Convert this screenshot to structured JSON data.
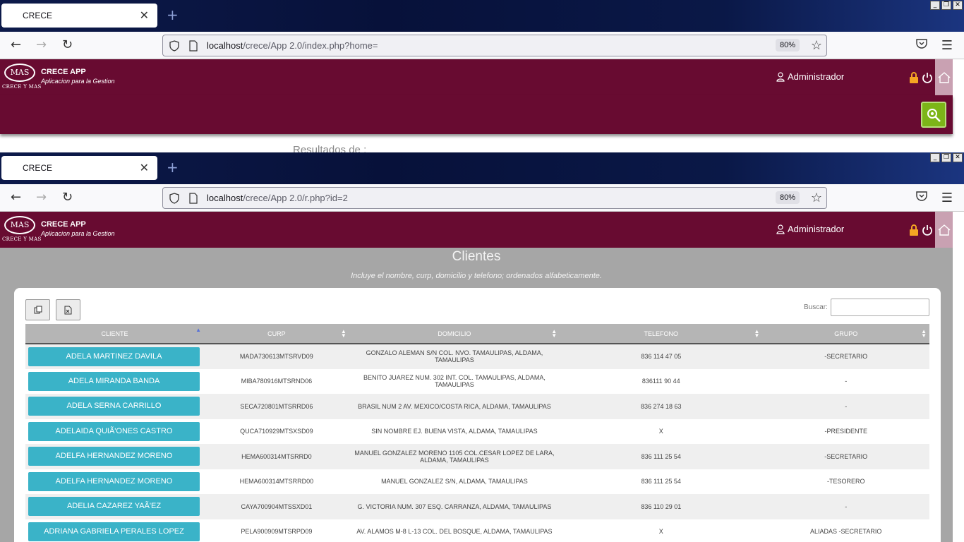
{
  "window1": {
    "tab_title": "CRECE",
    "url_host": "localhost",
    "url_path": "/crece/App 2.0/index.php?home=",
    "zoom": "80%",
    "results_label": "Resultados de :"
  },
  "window2": {
    "tab_title": "CRECE",
    "url_host": "localhost",
    "url_path": "/crece/App 2.0/r.php?id=2",
    "zoom": "80%"
  },
  "app": {
    "logo_text": "MAS",
    "logo_sub": "CRECE Y MAS",
    "name": "CRECE APP",
    "subtitle": "Aplicacion para la Gestion",
    "user": "Administrador",
    "colors": {
      "header": "#680b31",
      "accent_button": "#3ab3c8",
      "search_button": "#7cb518"
    }
  },
  "report": {
    "title": "Clientes",
    "description": "Incluye el nombre, curp, domicilio y telefono; ordenados alfabeticamente.",
    "search_label": "Buscar:",
    "search_value": "",
    "columns": [
      "CLIENTE",
      "CURP",
      "DOMICILIO",
      "TELEFONO",
      "GRUPO"
    ],
    "rows": [
      {
        "cliente": "ADELA MARTINEZ DAVILA",
        "curp": "MADA730613MTSRVD09",
        "domicilio": "GONZALO ALEMAN S/N COL. NVO. TAMAULIPAS, ALDAMA, TAMAULIPAS",
        "telefono": "836 114 47 05",
        "grupo": "-SECRETARIO"
      },
      {
        "cliente": "ADELA MIRANDA BANDA",
        "curp": "MIBA780916MTSRND06",
        "domicilio": "BENITO JUAREZ NUM. 302 INT. COL. TAMAULIPAS, ALDAMA, TAMAULIPAS",
        "telefono": "836111 90 44",
        "grupo": "-"
      },
      {
        "cliente": "ADELA SERNA CARRILLO",
        "curp": "SECA720801MTSRRD06",
        "domicilio": "BRASIL NUM 2 AV. MEXICO/COSTA RICA, ALDAMA, TAMAULIPAS",
        "telefono": "836 274 18 63",
        "grupo": "-"
      },
      {
        "cliente": "ADELAIDA QUIÃ'ONES CASTRO",
        "curp": "QUCA710929MTSXSD09",
        "domicilio": "SIN NOMBRE EJ. BUENA VISTA, ALDAMA, TAMAULIPAS",
        "telefono": "X",
        "grupo": "-PRESIDENTE"
      },
      {
        "cliente": "ADELFA HERNANDEZ MORENO",
        "curp": "HEMA600314MTSRRD0",
        "domicilio": "MANUEL GONZALEZ MORENO 1105 COL.CESAR LOPEZ DE LARA, ALDAMA, TAMAULIPAS",
        "telefono": "836 111 25 54",
        "grupo": "-SECRETARIO"
      },
      {
        "cliente": "ADELFA HERNANDEZ MORENO",
        "curp": "HEMA600314MTSRRD00",
        "domicilio": "MANUEL GONZALEZ S/N, ALDAMA, TAMAULIPAS",
        "telefono": "836 111 25 54",
        "grupo": "-TESORERO"
      },
      {
        "cliente": "ADELIA CAZAREZ YAÃ'EZ",
        "curp": "CAYA700904MTSSXD01",
        "domicilio": "G. VICTORIA NUM. 307 ESQ. CARRANZA, ALDAMA, TAMAULIPAS",
        "telefono": "836 110 29 01",
        "grupo": "-"
      },
      {
        "cliente": "ADRIANA GABRIELA PERALES LOPEZ",
        "curp": "PELA900909MTSRPD09",
        "domicilio": "AV. ALAMOS M-8 L-13 COL. DEL BOSQUE, ALDAMA, TAMAULIPAS",
        "telefono": "X",
        "grupo": "ALIADAS -SECRETARIO"
      }
    ]
  }
}
